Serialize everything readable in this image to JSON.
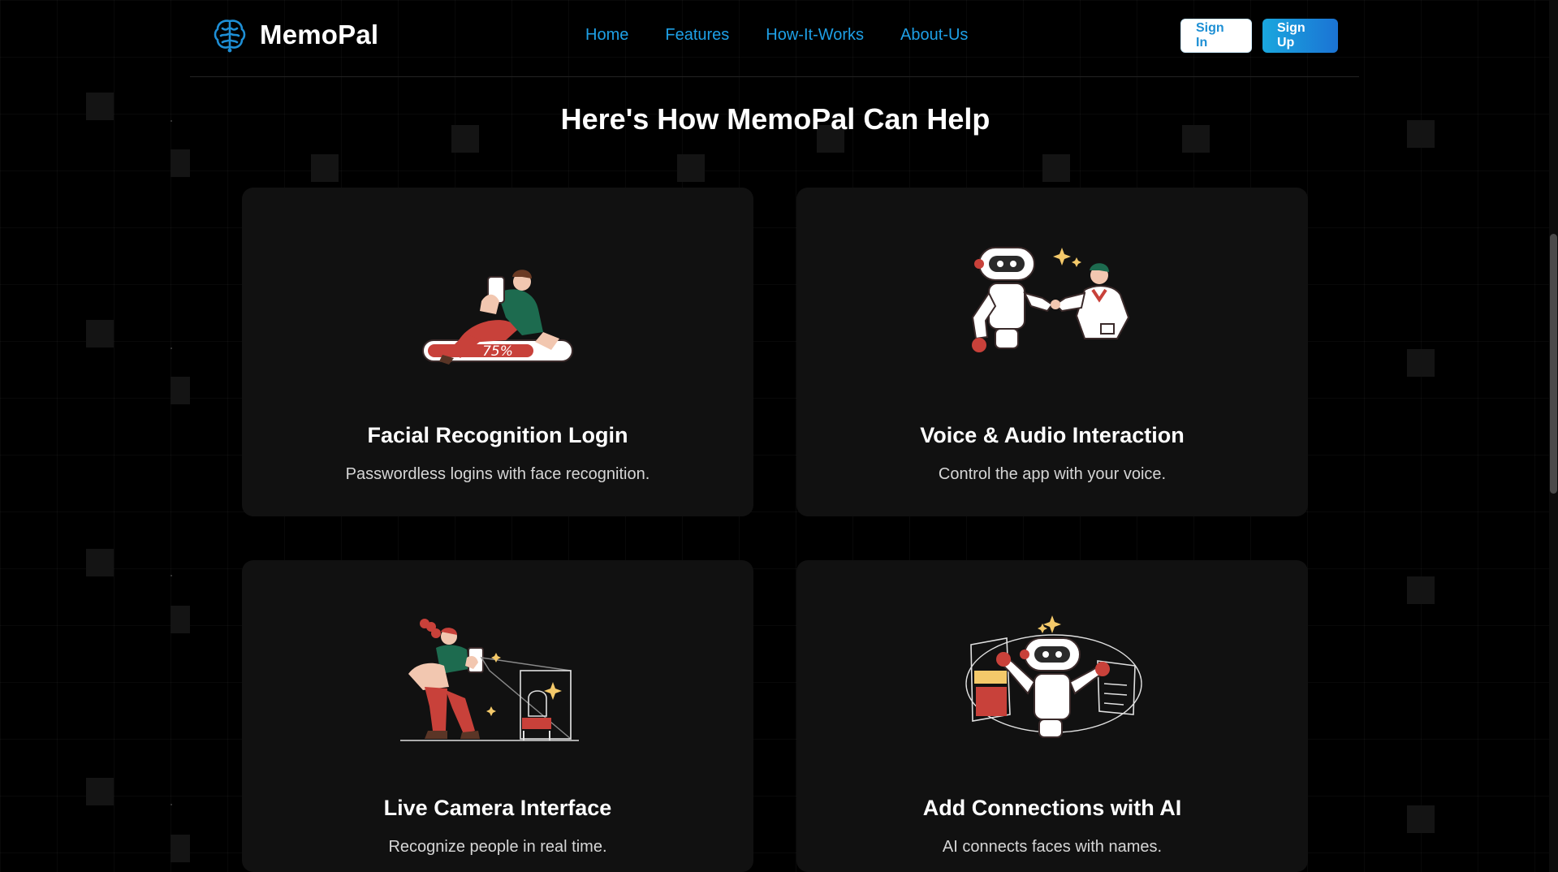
{
  "brand": {
    "name": "MemoPal",
    "logo_icon": "brain-circuit-icon",
    "accent": "#1ea0e6"
  },
  "nav": {
    "items": [
      {
        "label": "Home"
      },
      {
        "label": "Features"
      },
      {
        "label": "How-It-Works"
      },
      {
        "label": "About-Us"
      }
    ]
  },
  "auth": {
    "sign_in_label": "Sign In",
    "sign_up_label": "Sign Up"
  },
  "section": {
    "title": "Here's How MemoPal Can Help"
  },
  "cards": [
    {
      "title": "Facial Recognition Login",
      "description": "Passwordless logins with face recognition.",
      "illustration": "person-on-progress-bar-illustration",
      "progress_label": "75%"
    },
    {
      "title": "Voice & Audio Interaction",
      "description": "Control the app with your voice.",
      "illustration": "robot-high-five-illustration"
    },
    {
      "title": "Live Camera Interface",
      "description": "Recognize people in real time.",
      "illustration": "person-with-camera-illustration"
    },
    {
      "title": "Add Connections with AI",
      "description": "AI connects faces with names.",
      "illustration": "robot-with-panels-illustration"
    }
  ]
}
